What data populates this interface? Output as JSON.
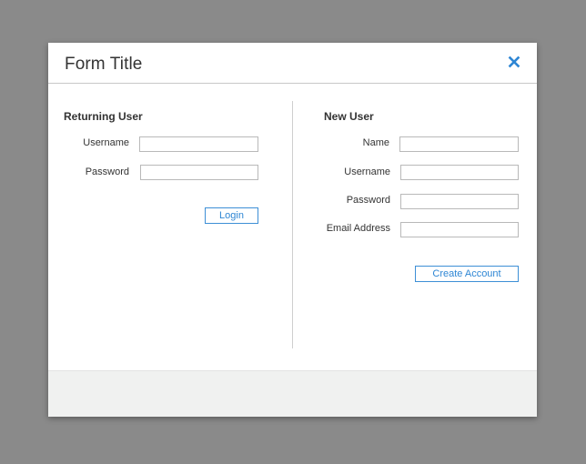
{
  "modal": {
    "title": "Form Title",
    "close_icon": "close-icon"
  },
  "returning_user": {
    "heading": "Returning User",
    "username_label": "Username",
    "username_value": "",
    "password_label": "Password",
    "password_value": "",
    "login_button": "Login"
  },
  "new_user": {
    "heading": "New User",
    "name_label": "Name",
    "name_value": "",
    "username_label": "Username",
    "username_value": "",
    "password_label": "Password",
    "password_value": "",
    "email_label": "Email Address",
    "email_value": "",
    "create_button": "Create Account"
  },
  "colors": {
    "backdrop": "#8a8a8a",
    "accent": "#2e86d4",
    "footer": "#f0f1f0"
  }
}
